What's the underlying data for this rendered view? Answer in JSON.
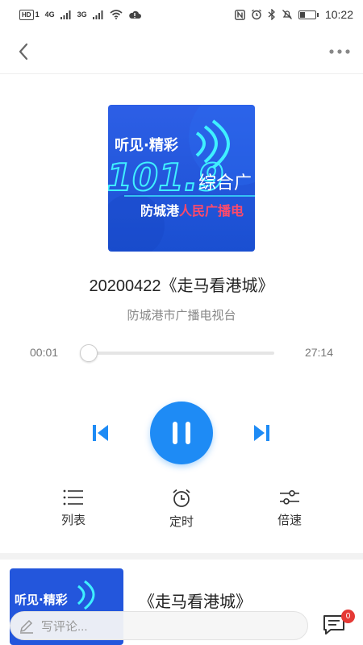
{
  "status_bar": {
    "hd_label": "HD",
    "hd_sub": "1",
    "net_1": "4G",
    "net_2": "3G",
    "time": "10:22",
    "battery_level": 0.35
  },
  "nav": {
    "back_icon": "chevron-left-icon",
    "more_icon": "more-dots-icon"
  },
  "cover": {
    "slogan": "听见·精彩",
    "frequency": "101.9",
    "channel": "综合广",
    "station": "防城港人民广播电",
    "colors": {
      "bg": "#1f5fdc",
      "accent": "#3ff0ff",
      "highlight": "#ff4a6a"
    }
  },
  "track": {
    "title": "20200422《走马看港城》",
    "source": "防城港市广播电视台",
    "current_time": "00:01",
    "total_time": "27:14",
    "progress": 0.0
  },
  "controls": {
    "prev_icon": "skip-previous-icon",
    "pause_icon": "pause-icon",
    "next_icon": "skip-next-icon",
    "accent": "#1e8bf5"
  },
  "tools": {
    "list_label": "列表",
    "timer_label": "定时",
    "speed_label": "倍速"
  },
  "related": {
    "title": "《走马看港城》",
    "cover_slogan": "听见·精彩"
  },
  "comment": {
    "placeholder": "写评论...",
    "count": "0"
  }
}
